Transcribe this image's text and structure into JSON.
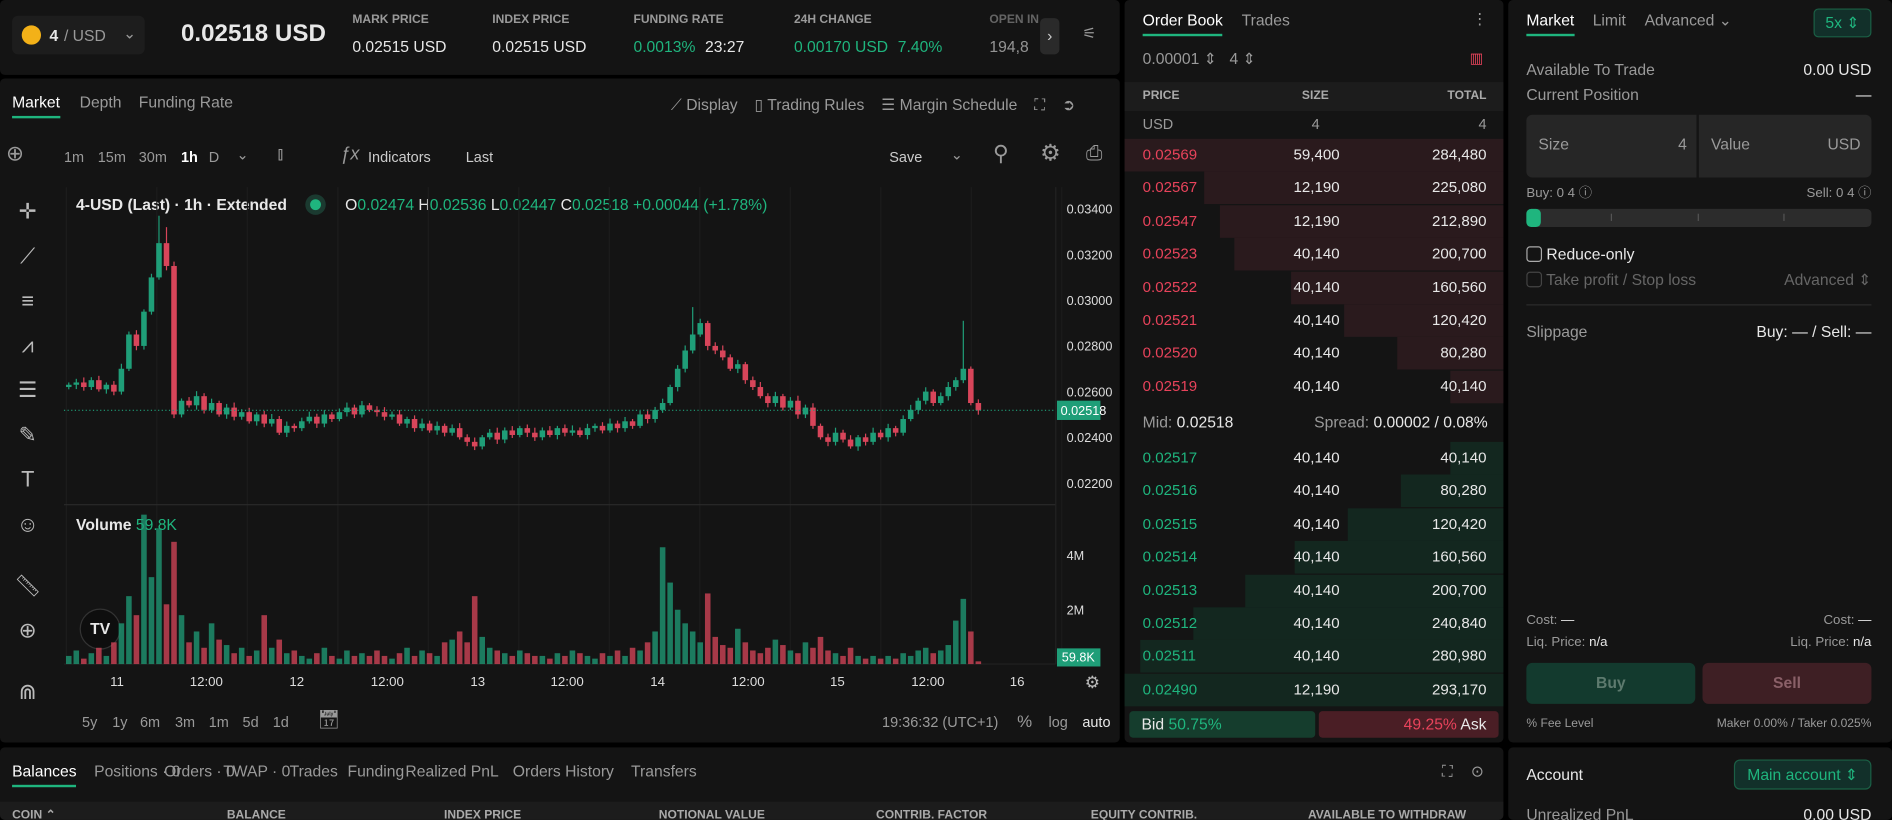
{
  "header": {
    "pair_base": "4",
    "pair_quote": "/ USD",
    "last_price": "0.02518 USD",
    "stats": [
      {
        "label": "MARK PRICE",
        "value": "0.02515 USD"
      },
      {
        "label": "INDEX PRICE",
        "value": "0.02515 USD"
      },
      {
        "label": "FUNDING RATE",
        "value": "0.0013%",
        "extra": "23:27"
      },
      {
        "label": "24H CHANGE",
        "value": "0.00170 USD",
        "extra": "7.40%"
      },
      {
        "label": "OPEN IN",
        "value": "194,8"
      }
    ]
  },
  "chart_panel": {
    "tabs": [
      "Market",
      "Depth",
      "Funding Rate"
    ],
    "actions": [
      "Display",
      "Trading Rules",
      "Margin Schedule"
    ],
    "intervals": [
      "1m",
      "15m",
      "30m",
      "1h",
      "D"
    ],
    "indicators": "Indicators",
    "last": "Last",
    "save": "Save",
    "legend": {
      "title": "4-USD (Last) · 1h · Extended",
      "o": "0.02474",
      "h": "0.02536",
      "l": "0.02447",
      "c": "0.02518",
      "chg": "+0.00044 (+1.78%)"
    },
    "volume_label": "Volume",
    "volume_value": "59.8K",
    "ranges": [
      "5y",
      "1y",
      "6m",
      "3m",
      "1m",
      "5d",
      "1d"
    ],
    "clock": "19:36:32 (UTC+1)",
    "pct": "%",
    "log": "log",
    "auto": "auto"
  },
  "chart_data": {
    "type": "candlestick",
    "price_ticks": [
      "0.03400",
      "0.03200",
      "0.03000",
      "0.02800",
      "0.02600",
      "0.02400",
      "0.02200"
    ],
    "last_price_label": "0.02518",
    "volume_ticks": [
      "4M",
      "2M"
    ],
    "volume_last_label": "59.8K",
    "x_ticks": [
      "11",
      "12:00",
      "12",
      "12:00",
      "13",
      "12:00",
      "14",
      "12:00",
      "15",
      "12:00",
      "16"
    ],
    "ylim": [
      0.022,
      0.034
    ],
    "close": [
      0.0263,
      0.0264,
      0.0262,
      0.0265,
      0.0261,
      0.0263,
      0.026,
      0.027,
      0.0285,
      0.028,
      0.0295,
      0.031,
      0.0325,
      0.0315,
      0.025,
      0.0256,
      0.0254,
      0.0258,
      0.0252,
      0.0255,
      0.025,
      0.0253,
      0.0249,
      0.0251,
      0.0247,
      0.025,
      0.0246,
      0.0248,
      0.0242,
      0.0245,
      0.0244,
      0.0247,
      0.0249,
      0.0246,
      0.025,
      0.0248,
      0.0251,
      0.0253,
      0.025,
      0.0254,
      0.0252,
      0.0251,
      0.0249,
      0.025,
      0.0246,
      0.0248,
      0.0244,
      0.0246,
      0.0243,
      0.0245,
      0.0242,
      0.0244,
      0.024,
      0.0238,
      0.0236,
      0.024,
      0.0242,
      0.0239,
      0.0243,
      0.0241,
      0.0244,
      0.0242,
      0.024,
      0.0243,
      0.0241,
      0.0244,
      0.0242,
      0.0243,
      0.0241,
      0.0244,
      0.0245,
      0.0243,
      0.0246,
      0.0244,
      0.0247,
      0.0245,
      0.025,
      0.0248,
      0.0252,
      0.0255,
      0.0262,
      0.027,
      0.0278,
      0.0285,
      0.029,
      0.028,
      0.0278,
      0.0275,
      0.027,
      0.0272,
      0.0265,
      0.0262,
      0.0258,
      0.0255,
      0.0258,
      0.0253,
      0.0256,
      0.025,
      0.0253,
      0.0245,
      0.024,
      0.0238,
      0.0242,
      0.0239,
      0.0236,
      0.024,
      0.0238,
      0.0242,
      0.024,
      0.0244,
      0.0242,
      0.0248,
      0.0252,
      0.0256,
      0.026,
      0.0255,
      0.0258,
      0.0262,
      0.0265,
      0.027,
      0.0255,
      0.02518
    ],
    "volume_m": [
      0.3,
      0.5,
      0.2,
      0.4,
      0.6,
      0.3,
      0.8,
      1.5,
      2.5,
      1.8,
      5.5,
      3.2,
      5.0,
      2.2,
      4.5,
      1.8,
      0.8,
      1.2,
      0.6,
      1.5,
      0.9,
      0.7,
      0.4,
      0.6,
      0.3,
      0.5,
      1.8,
      0.6,
      0.9,
      0.4,
      0.5,
      0.3,
      0.2,
      0.4,
      0.6,
      0.3,
      0.2,
      0.5,
      0.3,
      0.4,
      0.3,
      0.5,
      0.3,
      0.2,
      0.4,
      0.6,
      0.3,
      0.5,
      0.4,
      0.3,
      0.8,
      0.9,
      1.2,
      0.8,
      2.5,
      1.0,
      0.6,
      0.5,
      0.4,
      0.3,
      0.5,
      0.4,
      0.3,
      0.3,
      0.2,
      0.4,
      0.3,
      0.5,
      0.4,
      0.3,
      0.2,
      0.4,
      0.3,
      0.5,
      0.3,
      0.6,
      0.5,
      0.8,
      1.2,
      4.3,
      3.0,
      2.0,
      1.5,
      1.2,
      0.8,
      2.6,
      1.0,
      0.7,
      0.6,
      1.3,
      0.8,
      0.5,
      0.4,
      0.6,
      0.9,
      0.7,
      0.5,
      0.4,
      0.8,
      0.6,
      1.0,
      0.5,
      0.4,
      0.3,
      0.6,
      0.3,
      0.2,
      0.3,
      0.2,
      0.3,
      0.2,
      0.4,
      0.3,
      0.5,
      0.6,
      0.4,
      0.5,
      0.7,
      1.6,
      2.4,
      1.2,
      0.1
    ],
    "up_color": "#1f9e78",
    "down_color": "#d8455a"
  },
  "order_book": {
    "tabs": [
      "Order Book",
      "Trades"
    ],
    "tick": "0.00001",
    "group": "4",
    "cols": [
      "PRICE",
      "SIZE",
      "TOTAL"
    ],
    "units": [
      "USD",
      "4",
      "4"
    ],
    "asks": [
      [
        "0.02569",
        "59,400",
        "284,480"
      ],
      [
        "0.02567",
        "12,190",
        "225,080"
      ],
      [
        "0.02547",
        "12,190",
        "212,890"
      ],
      [
        "0.02523",
        "40,140",
        "200,700"
      ],
      [
        "0.02522",
        "40,140",
        "160,560"
      ],
      [
        "0.02521",
        "40,140",
        "120,420"
      ],
      [
        "0.02520",
        "40,140",
        "80,280"
      ],
      [
        "0.02519",
        "40,140",
        "40,140"
      ]
    ],
    "ask_depth": [
      1.0,
      0.79,
      0.75,
      0.71,
      0.56,
      0.42,
      0.28,
      0.14
    ],
    "mid_label": "Mid:",
    "mid": "0.02518",
    "spread_label": "Spread:",
    "spread": "0.00002 / 0.08%",
    "bids": [
      [
        "0.02517",
        "40,140",
        "40,140"
      ],
      [
        "0.02516",
        "40,140",
        "80,280"
      ],
      [
        "0.02515",
        "40,140",
        "120,420"
      ],
      [
        "0.02514",
        "40,140",
        "160,560"
      ],
      [
        "0.02513",
        "40,140",
        "200,700"
      ],
      [
        "0.02512",
        "40,140",
        "240,840"
      ],
      [
        "0.02511",
        "40,140",
        "280,980"
      ],
      [
        "0.02490",
        "12,190",
        "293,170"
      ]
    ],
    "bid_depth": [
      0.14,
      0.27,
      0.41,
      0.55,
      0.68,
      0.82,
      0.96,
      1.0
    ],
    "bid_label": "Bid",
    "bid_pct": "50.75%",
    "ask_pct": "49.25%",
    "ask_label": "Ask",
    "bid_ratio": 0.5075
  },
  "order_form": {
    "tabs": [
      "Market",
      "Limit",
      "Advanced"
    ],
    "leverage": "5x",
    "available_label": "Available To Trade",
    "available": "0.00 USD",
    "position_label": "Current Position",
    "position": "—",
    "size_label": "Size",
    "size_unit": "4",
    "value_label": "Value",
    "value_unit": "USD",
    "buy_info": "Buy: 0 4",
    "sell_info": "Sell: 0 4",
    "slider_percent": 0,
    "reduce_only": "Reduce-only",
    "tpsl": "Take profit / Stop loss",
    "tpsl_mode": "Advanced",
    "slippage_label": "Slippage",
    "slippage": "Buy: — / Sell: —",
    "cost_label": "Cost:",
    "cost": "—",
    "liq_label": "Liq. Price:",
    "liq": "n/a",
    "buy": "Buy",
    "sell": "Sell",
    "fee_level": "Fee Level",
    "fees": "Maker 0.00% / Taker 0.025%"
  },
  "bottom": {
    "tabs": [
      "Balances",
      "Positions · 0",
      "Orders · 0",
      "TWAP · 0",
      "Trades",
      "Funding",
      "Realized PnL",
      "Orders History",
      "Transfers"
    ],
    "columns": [
      "COIN ⌃",
      "BALANCE",
      "INDEX PRICE",
      "NOTIONAL VALUE",
      "CONTRIB. FACTOR",
      "EQUITY CONTRIB.",
      "AVAILABLE TO WITHDRAW"
    ]
  },
  "account": {
    "title": "Account",
    "selector": "Main account",
    "row_label": "Unrealized PnL",
    "row_value": "0.00 USD"
  }
}
